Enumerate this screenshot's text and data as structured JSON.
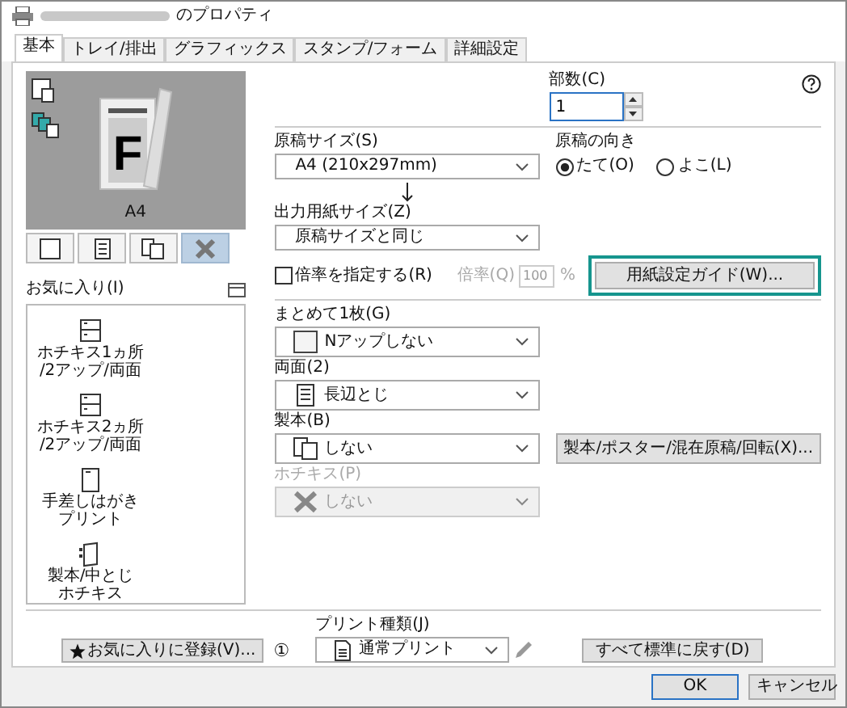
{
  "window": {
    "title": "のプロパティ"
  },
  "tabs": [
    {
      "label": "基本",
      "selected": true
    },
    {
      "label": "トレイ/排出",
      "selected": false
    },
    {
      "label": "グラフィックス",
      "selected": false
    },
    {
      "label": "スタンプ/フォーム",
      "selected": false
    },
    {
      "label": "詳細設定",
      "selected": false
    }
  ],
  "preview": {
    "page_letter": "F",
    "paper_label": "A4"
  },
  "view_buttons": [
    {
      "kind": "single",
      "selected": false
    },
    {
      "kind": "duplex",
      "selected": false
    },
    {
      "kind": "booklet",
      "selected": false
    },
    {
      "kind": "staple",
      "selected": true
    }
  ],
  "favorites": {
    "label": "お気に入り(I)",
    "items": [
      {
        "kind": "staple",
        "lines": [
          "ホチキス1ヵ所",
          "/2アップ/両面"
        ]
      },
      {
        "kind": "staple",
        "lines": [
          "ホチキス2ヵ所",
          "/2アップ/両面"
        ]
      },
      {
        "kind": "postcard",
        "lines": [
          "手差しはがき",
          "プリント"
        ]
      },
      {
        "kind": "booklet",
        "lines": [
          "製本/中とじ",
          "ホチキス"
        ]
      }
    ]
  },
  "copies": {
    "label": "部数(C)",
    "value": "1"
  },
  "original_size": {
    "label": "原稿サイズ(S)",
    "value": "A4 (210x297mm)"
  },
  "orientation": {
    "label": "原稿の向き",
    "options": [
      {
        "label": "たて(O)",
        "selected": true
      },
      {
        "label": "よこ(L)",
        "selected": false
      }
    ]
  },
  "output_size": {
    "label": "出力用紙サイズ(Z)",
    "value": "原稿サイズと同じ"
  },
  "scale": {
    "label": "倍率を指定する(R)",
    "checked": false,
    "rate_label": "倍率(Q)",
    "rate_value": "100",
    "unit": "%"
  },
  "paper_guide_button": {
    "label": "用紙設定ガイド(W)...",
    "highlighted": true
  },
  "layout": {
    "label": "まとめて1枚(G)",
    "value": "Nアップしない"
  },
  "duplex": {
    "label": "両面(2)",
    "value": "長辺とじ"
  },
  "booklet": {
    "label": "製本(B)",
    "value": "しない",
    "button": "製本/ポスター/混在原稿/回転(X)..."
  },
  "staple": {
    "label": "ホチキス(P)",
    "value": "しない",
    "disabled": true
  },
  "footer": {
    "favorite_button": "お気に入りに登録(V)...",
    "info_mark": "①",
    "print_type": {
      "label": "プリント種類(J)",
      "value": "通常プリント"
    },
    "reset_button": "すべて標準に戻す(D)"
  },
  "buttons": [
    {
      "label": "OK",
      "kind": "default"
    },
    {
      "label": "キャンセル",
      "kind": "normal"
    }
  ]
}
